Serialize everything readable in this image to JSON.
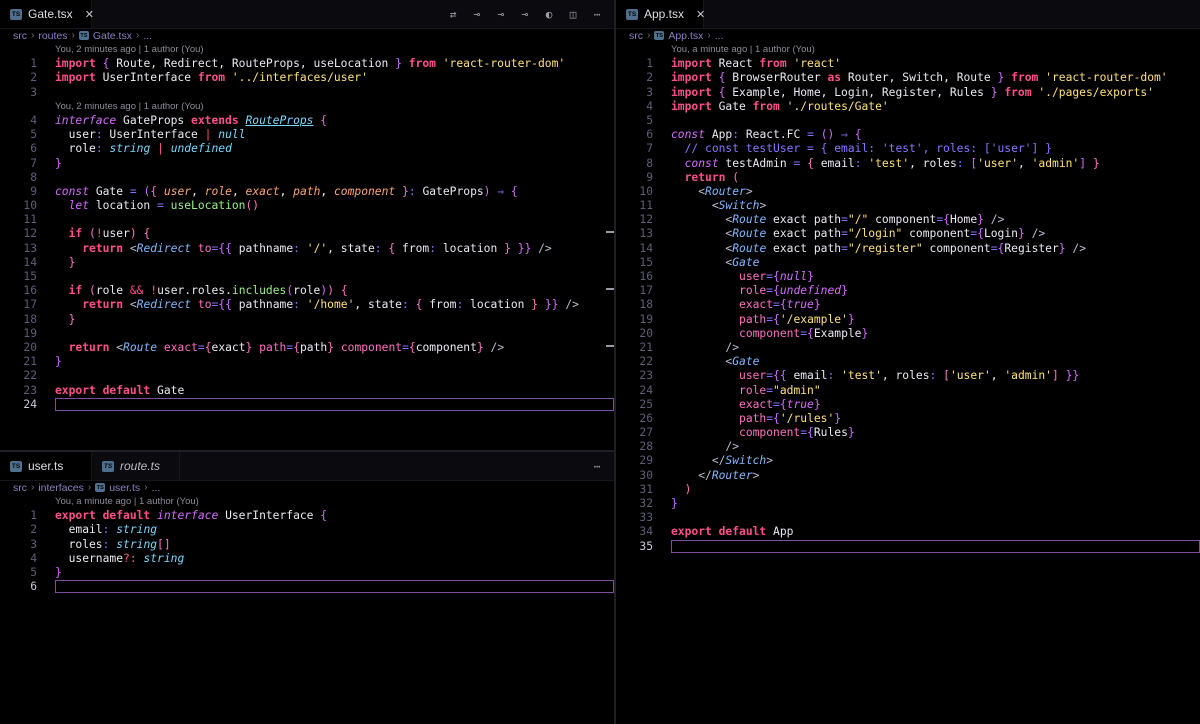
{
  "editor": {
    "gate_pane": {
      "tab_label": "Gate.tsx",
      "tab_icon": "ts-file-icon",
      "breadcrumb": [
        "src",
        "routes",
        "Gate.tsx",
        "..."
      ],
      "toolbar_icons": [
        "source-control-diff-icon",
        "git-commit-icon",
        "previous-change-icon",
        "next-change-icon",
        "git-lens-icon",
        "split-editor-icon",
        "more-actions-icon"
      ],
      "blame_1": "You, 2 minutes ago | 1 author (You)",
      "blame_2": "You, 2 minutes ago | 1 author (You)",
      "current_line": 24,
      "lines": [
        {
          "n": "1",
          "html": "<span class=\"kw\">import</span> <span class=\"br\">{</span> Route, Redirect, RouteProps, useLocation <span class=\"br\">}</span> <span class=\"kw\">from</span> <span class=\"str\">'react-router-dom'</span>"
        },
        {
          "n": "2",
          "html": "<span class=\"kw\">import</span> UserInterface <span class=\"kw\">from</span> <span class=\"str\">'../interfaces/user'</span>"
        },
        {
          "n": "3",
          "html": ""
        },
        {
          "blame": "gate_pane.blame_2"
        },
        {
          "n": "4",
          "html": "<span class=\"kwi\">interface</span> GateProps <span class=\"kw\">extends</span> <span class=\"tyu\">RouteProps</span> <span class=\"br\">{</span>"
        },
        {
          "n": "5",
          "html": "  user<span class=\"op\">:</span> UserInterface <span class=\"oppink\">|</span> <span class=\"ty\">null</span>"
        },
        {
          "n": "6",
          "html": "  role<span class=\"op\">:</span> <span class=\"ty\">string</span> <span class=\"oppink\">|</span> <span class=\"ty\">undefined</span>"
        },
        {
          "n": "7",
          "html": "<span class=\"br\">}</span>"
        },
        {
          "n": "8",
          "html": ""
        },
        {
          "n": "9",
          "html": "<span class=\"kwi\">const</span> Gate <span class=\"op\">=</span> <span class=\"br\">(</span><span class=\"br2\">{</span> <span class=\"par\">user</span>, <span class=\"par\">role</span>, <span class=\"par\">exact</span>, <span class=\"par\">path</span>, <span class=\"par\">component</span> <span class=\"br2\">}</span><span class=\"op\">:</span> GateProps<span class=\"br\">)</span> <span class=\"op\">⇒</span> <span class=\"br\">{</span>"
        },
        {
          "n": "10",
          "html": "  <span class=\"kwi\">let</span> location <span class=\"op\">=</span> <span class=\"fn\">useLocation</span><span class=\"br2\">()</span>"
        },
        {
          "n": "11",
          "html": ""
        },
        {
          "n": "12",
          "html": "  <span class=\"kw\">if</span> <span class=\"br2\">(</span><span class=\"oppink\">!</span>user<span class=\"br2\">)</span> <span class=\"br2\">{</span>"
        },
        {
          "n": "13",
          "html": "    <span class=\"kw\">return</span> <span class=\"pu\">&lt;</span><span class=\"tag\">Redirect</span> <span class=\"at\">to</span><span class=\"op\">=</span><span class=\"br\">{{</span> pathname<span class=\"op\">:</span> <span class=\"str\">'/'</span>, state<span class=\"op\">:</span> <span class=\"br2\">{</span> from<span class=\"op\">:</span> location <span class=\"br2\">}</span> <span class=\"br\">}}</span> <span class=\"pu\">/&gt;</span>"
        },
        {
          "n": "14",
          "html": "  <span class=\"br2\">}</span>"
        },
        {
          "n": "15",
          "html": ""
        },
        {
          "n": "16",
          "html": "  <span class=\"kw\">if</span> <span class=\"br2\">(</span>role <span class=\"oppink\">&amp;&amp;</span> <span class=\"oppink\">!</span>user.roles.<span class=\"fn\">includes</span><span class=\"br\">(</span>role<span class=\"br\">)</span><span class=\"br2\">)</span> <span class=\"br2\">{</span>"
        },
        {
          "n": "17",
          "html": "    <span class=\"kw\">return</span> <span class=\"pu\">&lt;</span><span class=\"tag\">Redirect</span> <span class=\"at\">to</span><span class=\"op\">=</span><span class=\"br\">{{</span> pathname<span class=\"op\">:</span> <span class=\"str\">'/home'</span>, state<span class=\"op\">:</span> <span class=\"br2\">{</span> from<span class=\"op\">:</span> location <span class=\"br2\">}</span> <span class=\"br\">}}</span> <span class=\"pu\">/&gt;</span>"
        },
        {
          "n": "18",
          "html": "  <span class=\"br2\">}</span>"
        },
        {
          "n": "19",
          "html": ""
        },
        {
          "n": "20",
          "html": "  <span class=\"kw\">return</span> <span class=\"pu\">&lt;</span><span class=\"tag\">Route</span> <span class=\"at\">exact</span><span class=\"op\">=</span><span class=\"br2\">{</span>exact<span class=\"br2\">}</span> <span class=\"at\">path</span><span class=\"op\">=</span><span class=\"br2\">{</span>path<span class=\"br2\">}</span> <span class=\"at\">component</span><span class=\"op\">=</span><span class=\"br2\">{</span>component<span class=\"br2\">}</span> <span class=\"pu\">/&gt;</span>"
        },
        {
          "n": "21",
          "html": "<span class=\"br\">}</span>"
        },
        {
          "n": "22",
          "html": ""
        },
        {
          "n": "23",
          "html": "<span class=\"kw\">export</span> <span class=\"kw\">default</span> Gate"
        },
        {
          "n": "24",
          "html": ""
        }
      ]
    },
    "user_pane": {
      "tabs": [
        {
          "label": "user.ts",
          "icon": "ts-file-icon"
        },
        {
          "label": "route.ts",
          "icon": "ts-file-icon"
        }
      ],
      "more_icon": "⋯",
      "breadcrumb": [
        "src",
        "interfaces",
        "user.ts",
        "..."
      ],
      "blame_1": "You, a minute ago | 1 author (You)",
      "current_line": 6,
      "lines": [
        {
          "n": "1",
          "html": "<span class=\"kw\">export</span> <span class=\"kw\">default</span> <span class=\"kwi\">interface</span> UserInterface <span class=\"br\">{</span>"
        },
        {
          "n": "2",
          "html": "  email<span class=\"op\">:</span> <span class=\"ty\">string</span>"
        },
        {
          "n": "3",
          "html": "  roles<span class=\"op\">:</span> <span class=\"ty\">string</span><span class=\"br2\">[]</span>"
        },
        {
          "n": "4",
          "html": "  username<span class=\"oppink\">?:</span> <span class=\"ty\">string</span>"
        },
        {
          "n": "5",
          "html": "<span class=\"br\">}</span>"
        },
        {
          "n": "6",
          "html": ""
        }
      ]
    },
    "app_pane": {
      "tab_label": "App.tsx",
      "tab_icon": "ts-file-icon",
      "breadcrumb": [
        "src",
        "App.tsx",
        "..."
      ],
      "blame_1": "You, a minute ago | 1 author (You)",
      "current_line": 35,
      "lines": [
        {
          "n": "1",
          "html": "<span class=\"kw\">import</span> React <span class=\"kw\">from</span> <span class=\"str\">'react'</span>"
        },
        {
          "n": "2",
          "html": "<span class=\"kw\">import</span> <span class=\"br\">{</span> BrowserRouter <span class=\"kw\">as</span> Router, Switch, Route <span class=\"br\">}</span> <span class=\"kw\">from</span> <span class=\"str\">'react-router-dom'</span>"
        },
        {
          "n": "3",
          "html": "<span class=\"kw\">import</span> <span class=\"br\">{</span> Example, Home, Login, Register, Rules <span class=\"br\">}</span> <span class=\"kw\">from</span> <span class=\"str\">'./pages/exports'</span>"
        },
        {
          "n": "4",
          "html": "<span class=\"kw\">import</span> Gate <span class=\"kw\">from</span> <span class=\"str\">'./routes/Gate'</span>"
        },
        {
          "n": "5",
          "html": ""
        },
        {
          "n": "6",
          "html": "<span class=\"kwi\">const</span> App<span class=\"op\">:</span> React.FC <span class=\"op\">=</span> <span class=\"br\">()</span> <span class=\"op\">⇒</span> <span class=\"br\">{</span>"
        },
        {
          "n": "7",
          "html": "  <span class=\"cm\">// const testUser = { email: 'test', roles: ['user'] }</span>"
        },
        {
          "n": "8",
          "html": "  <span class=\"kwi\">const</span> testAdmin <span class=\"op\">=</span> <span class=\"br2\">{</span> email<span class=\"op\">:</span> <span class=\"str\">'test'</span>, roles<span class=\"op\">:</span> <span class=\"br\">[</span><span class=\"str\">'user'</span>, <span class=\"str\">'admin'</span><span class=\"br\">]</span> <span class=\"br2\">}</span>"
        },
        {
          "n": "9",
          "html": "  <span class=\"kw\">return</span> <span class=\"br2\">(</span>"
        },
        {
          "n": "10",
          "html": "    <span class=\"pu\">&lt;</span><span class=\"tag\">Router</span><span class=\"pu\">&gt;</span>"
        },
        {
          "n": "11",
          "html": "      <span class=\"pu\">&lt;</span><span class=\"tag\">Switch</span><span class=\"pu\">&gt;</span>"
        },
        {
          "n": "12",
          "html": "        <span class=\"pu\">&lt;</span><span class=\"tag\">Route</span> exact path<span class=\"op\">=</span><span class=\"str\">\"/\"</span> component<span class=\"op\">=</span><span class=\"br\">{</span>Home<span class=\"br\">}</span> <span class=\"pu\">/&gt;</span>"
        },
        {
          "n": "13",
          "html": "        <span class=\"pu\">&lt;</span><span class=\"tag\">Route</span> exact path<span class=\"op\">=</span><span class=\"str\">\"/login\"</span> component<span class=\"op\">=</span><span class=\"br\">{</span>Login<span class=\"br\">}</span> <span class=\"pu\">/&gt;</span>"
        },
        {
          "n": "14",
          "html": "        <span class=\"pu\">&lt;</span><span class=\"tag\">Route</span> exact path<span class=\"op\">=</span><span class=\"str\">\"/register\"</span> component<span class=\"op\">=</span><span class=\"br\">{</span>Register<span class=\"br\">}</span> <span class=\"pu\">/&gt;</span>"
        },
        {
          "n": "15",
          "html": "        <span class=\"pu\">&lt;</span><span class=\"tag\">Gate</span>"
        },
        {
          "n": "16",
          "html": "          <span class=\"at\">user</span><span class=\"op\">=</span><span class=\"br\">{</span><span class=\"kwi\">null</span><span class=\"br\">}</span>"
        },
        {
          "n": "17",
          "html": "          <span class=\"at\">role</span><span class=\"op\">=</span><span class=\"br\">{</span><span class=\"kwi\">undefined</span><span class=\"br\">}</span>"
        },
        {
          "n": "18",
          "html": "          <span class=\"at\">exact</span><span class=\"op\">=</span><span class=\"br\">{</span><span class=\"kwi\">true</span><span class=\"br\">}</span>"
        },
        {
          "n": "19",
          "html": "          <span class=\"at\">path</span><span class=\"op\">=</span><span class=\"br\">{</span><span class=\"str\">'/example'</span><span class=\"br\">}</span>"
        },
        {
          "n": "20",
          "html": "          <span class=\"at\">component</span><span class=\"op\">=</span><span class=\"br\">{</span>Example<span class=\"br\">}</span>"
        },
        {
          "n": "21",
          "html": "        <span class=\"pu\">/&gt;</span>"
        },
        {
          "n": "22",
          "html": "        <span class=\"pu\">&lt;</span><span class=\"tag\">Gate</span>"
        },
        {
          "n": "23",
          "html": "          <span class=\"at\">user</span><span class=\"op\">=</span><span class=\"br\">{{</span> email<span class=\"op\">:</span> <span class=\"str\">'test'</span>, roles<span class=\"op\">:</span> <span class=\"br2\">[</span><span class=\"str\">'user'</span>, <span class=\"str\">'admin'</span><span class=\"br2\">]</span> <span class=\"br\">}}</span>"
        },
        {
          "n": "24",
          "html": "          <span class=\"at\">role</span><span class=\"op\">=</span><span class=\"str\">\"admin\"</span>"
        },
        {
          "n": "25",
          "html": "          <span class=\"at\">exact</span><span class=\"op\">=</span><span class=\"br\">{</span><span class=\"kwi\">true</span><span class=\"br\">}</span>"
        },
        {
          "n": "26",
          "html": "          <span class=\"at\">path</span><span class=\"op\">=</span><span class=\"br\">{</span><span class=\"str\">'/rules'</span><span class=\"br\">}</span>"
        },
        {
          "n": "27",
          "html": "          <span class=\"at\">component</span><span class=\"op\">=</span><span class=\"br\">{</span>Rules<span class=\"br\">}</span>"
        },
        {
          "n": "28",
          "html": "        <span class=\"pu\">/&gt;</span>"
        },
        {
          "n": "29",
          "html": "      <span class=\"pu\">&lt;/</span><span class=\"tag\">Switch</span><span class=\"pu\">&gt;</span>"
        },
        {
          "n": "30",
          "html": "    <span class=\"pu\">&lt;/</span><span class=\"tag\">Router</span><span class=\"pu\">&gt;</span>"
        },
        {
          "n": "31",
          "html": "  <span class=\"br2\">)</span>"
        },
        {
          "n": "32",
          "html": "<span class=\"br\">}</span>"
        },
        {
          "n": "33",
          "html": ""
        },
        {
          "n": "34",
          "html": "<span class=\"kw\">export</span> <span class=\"kw\">default</span> App"
        },
        {
          "n": "35",
          "html": ""
        }
      ]
    }
  },
  "colors": {
    "background": "#000000",
    "keyword": "#ff4f8b",
    "string": "#ffe072",
    "type": "#78d8ff",
    "current_line_border": "#7a4fa0"
  }
}
